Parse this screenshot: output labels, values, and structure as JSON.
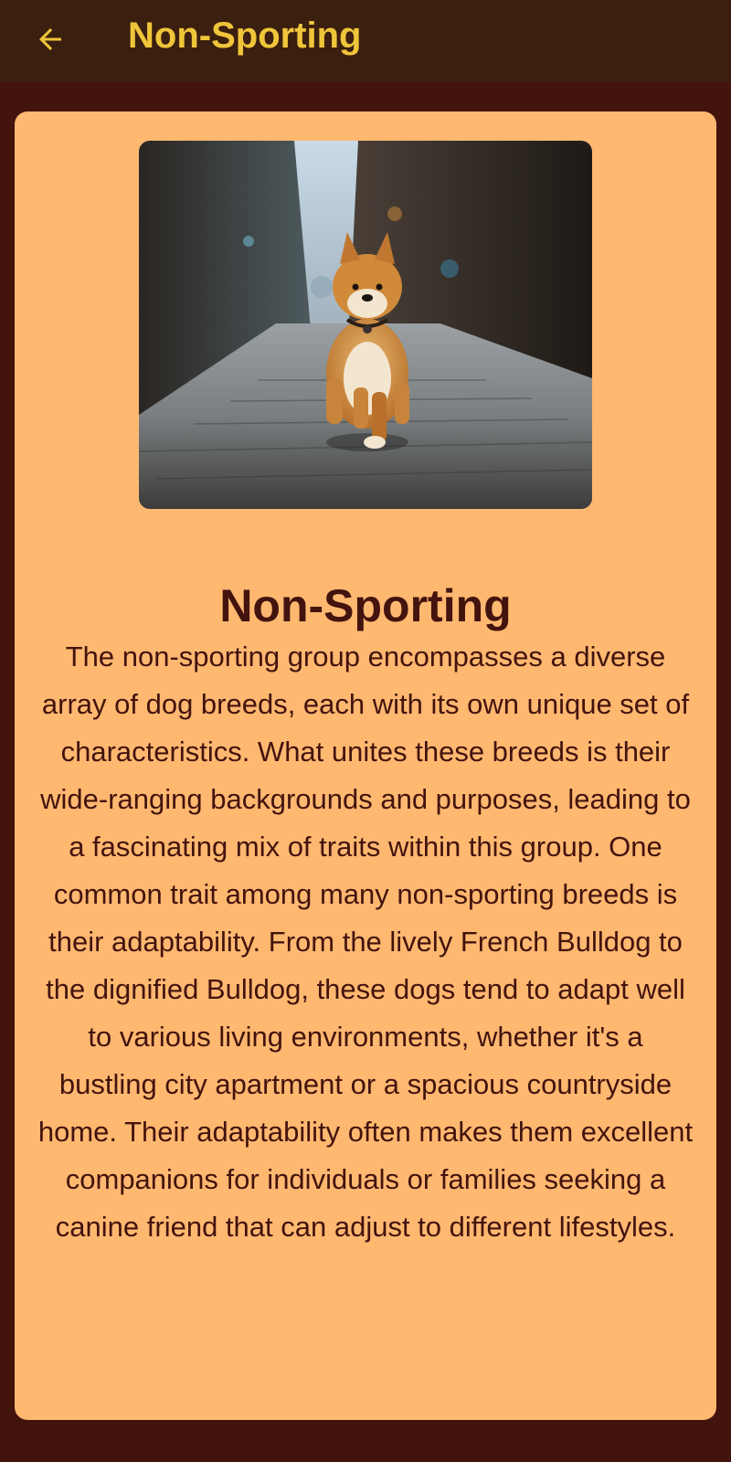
{
  "appbar": {
    "title": "Non-Sporting",
    "back_icon": "arrow-left-icon",
    "title_color": "#f0c53a",
    "background": "#3b200f"
  },
  "card": {
    "image_alt": "Shiba Inu running on a cobblestone street",
    "heading": "Non-Sporting",
    "description": "The non-sporting group encompasses a diverse array of dog breeds, each with its own unique set of characteristics. What unites these breeds is their wide-ranging backgrounds and purposes, leading to a fascinating mix of traits within this group. One common trait among many non-sporting breeds is their adaptability. From the lively French Bulldog to the dignified Bulldog, these dogs tend to adapt well to various living environments, whether it's a bustling city apartment or a spacious countryside home. Their adaptability often makes them excellent companions for individuals or families seeking a canine friend that can adjust to different lifestyles.",
    "background": "#ffb870",
    "text_color": "#43130e"
  },
  "page_background": "#43130e"
}
